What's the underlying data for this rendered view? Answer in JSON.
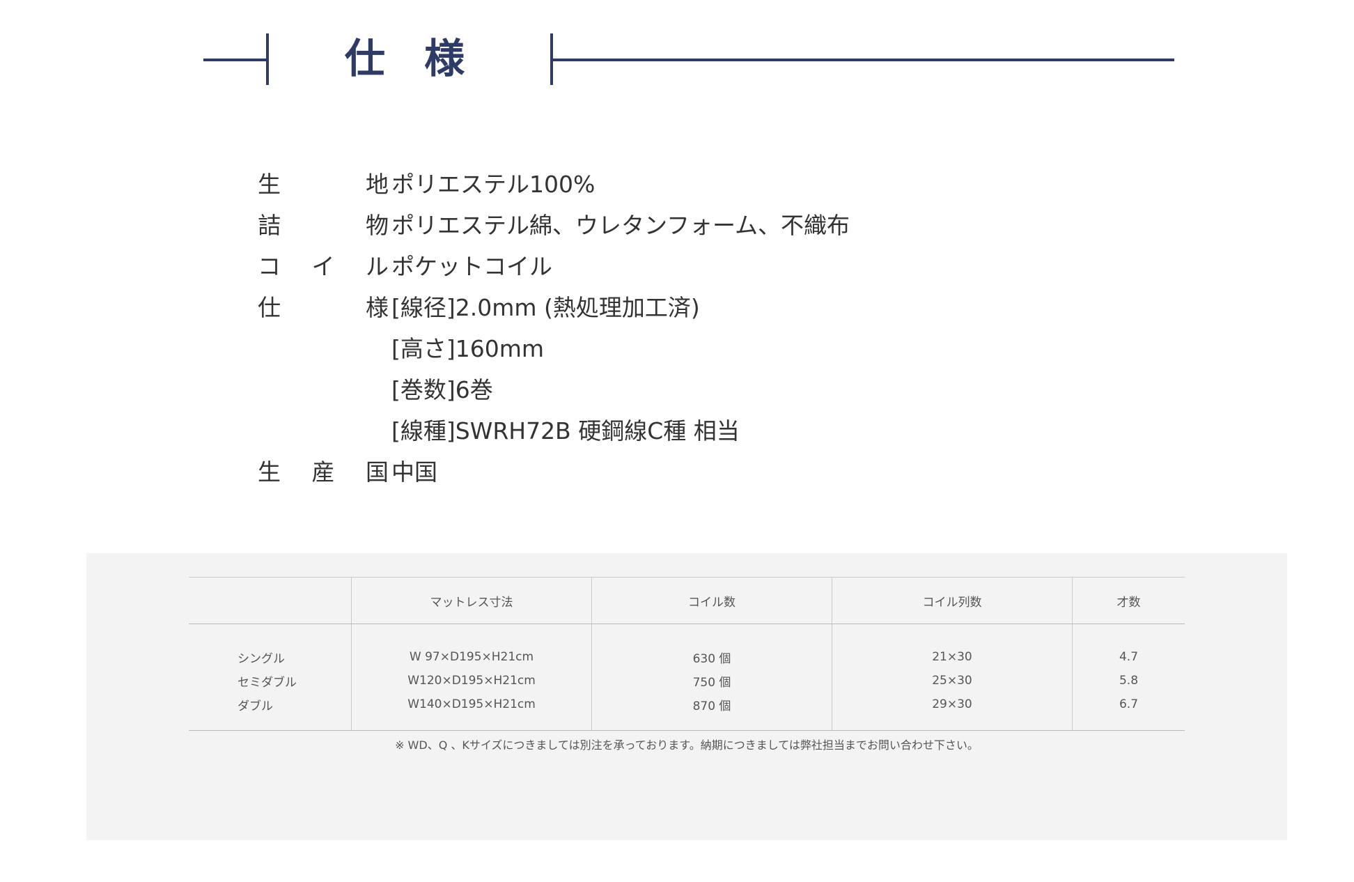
{
  "heading": {
    "title": "仕 様"
  },
  "colors": {
    "accent": "#2e3b66",
    "panel_bg": "#f3f3f3",
    "text": "#333333"
  },
  "spec": [
    {
      "label": [
        "生",
        "地"
      ],
      "value": "ポリエステル100%"
    },
    {
      "label": [
        "詰",
        "物"
      ],
      "value": "ポリエステル綿、ウレタンフォーム、不織布"
    },
    {
      "label": [
        "コ",
        "イ",
        "ル"
      ],
      "value": "ポケットコイル"
    },
    {
      "label": [
        "仕",
        "様"
      ],
      "value": "[線径]2.0mm (熱処理加工済)"
    },
    {
      "label": [],
      "value": "[高さ]160mm"
    },
    {
      "label": [],
      "value": "[巻数]6巻"
    },
    {
      "label": [],
      "value": "[線種]SWRH72B 硬鋼線C種 相当"
    },
    {
      "label": [
        "生",
        "産",
        "国"
      ],
      "value": "中国"
    }
  ],
  "table": {
    "headers": [
      "",
      "マットレス寸法",
      "コイル数",
      "コイル列数",
      "才数"
    ],
    "rows": [
      [
        "シングル",
        "W  97×D195×H21cm",
        "630 個",
        "21×30",
        "4.7"
      ],
      [
        "セミダブル",
        "W120×D195×H21cm",
        "750 個",
        "25×30",
        "5.8"
      ],
      [
        "ダブル",
        "W140×D195×H21cm",
        "870 個",
        "29×30",
        "6.7"
      ]
    ],
    "note": "※ WD、Q 、Kサイズにつきましては別注を承っております。納期につきましては弊社担当までお問い合わせ下さい。"
  }
}
